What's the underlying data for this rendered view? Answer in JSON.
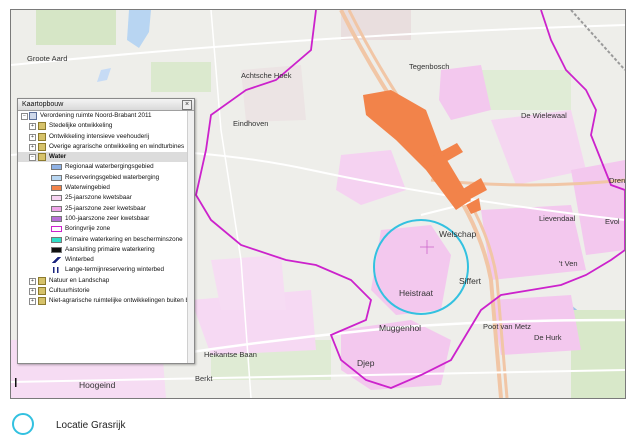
{
  "map": {
    "places": {
      "groote_aard": "Groote Aard",
      "achtsche_hoek": "Achtsche Hoek",
      "eindhoven": "Eindhoven",
      "tegenbosch": "Tegenbosch",
      "de_wielewaal": "De Wielewaal",
      "drents": "Drents",
      "lievendaal": "Lievendaal",
      "evol": "Evol",
      "welschap": "Welschap",
      "siffert": "Siffert",
      "t_ven": "'t Ven",
      "heistraat": "Heistraat",
      "muggenhol": "Muggenhol",
      "poot_van_metz": "Poot van Metz",
      "de_hurk": "De Hurk",
      "heikantse_baan": "Heikantse Baan",
      "berkt": "Berkt",
      "hoogeind": "Hoogeind",
      "djep": "Djep"
    },
    "colors": {
      "background": "#eeeeea",
      "residential": "#f3c8ee",
      "boundary": "#cc22cc",
      "water_extraction": "#f2834a",
      "location_circle": "#33c1e0"
    }
  },
  "layer_panel": {
    "title": "Kaartopbouw",
    "close_icon": "close-icon",
    "root": "Verordening ruimte Noord-Brabant 2011",
    "groups_top": [
      "Stedelijke ontwikkeling",
      "Ontwikkeling intensieve veehouderij",
      "Overige agrarische ontwikkeling en windturbines"
    ],
    "water_group": "Water",
    "water_items": [
      {
        "label": "Regionaal waterbergingsgebied",
        "color": "#8fb2e6",
        "kind": "fill"
      },
      {
        "label": "Reserveringsgebied waterberging",
        "color": "#b9d7f2",
        "kind": "fill"
      },
      {
        "label": "Waterwingebied",
        "color": "#f2834a",
        "kind": "fill"
      },
      {
        "label": "25-jaarszone kwetsbaar",
        "color": "#f7d4f3",
        "kind": "fill"
      },
      {
        "label": "25-jaarszone zeer kwetsbaar",
        "color": "#efa6e9",
        "kind": "fill"
      },
      {
        "label": "100-jaarszone zeer kwetsbaar",
        "color": "#b86fd6",
        "kind": "fill"
      },
      {
        "label": "Boringvrije zone",
        "color": "#cc22cc",
        "kind": "outline"
      },
      {
        "label": "Primaire waterkering en bescherminszone",
        "color": "#2fe0c8",
        "kind": "fill"
      },
      {
        "label": "Aansluiting primaire waterkering",
        "color": "#111111",
        "kind": "fill"
      },
      {
        "label": "Winterbed",
        "color": "#1a237e",
        "kind": "diagonal"
      },
      {
        "label": "Lange-termijnreservering winterbed",
        "color": "#1a237e",
        "kind": "bars"
      }
    ],
    "groups_bottom": [
      "Natuur en Landschap",
      "Cultuurhistorie",
      "Niet-agrarische ruimtelijke ontwikkelingen buiten b"
    ]
  },
  "legend": {
    "label": "Locatie Grasrijk",
    "symbol": "location-circle-icon"
  }
}
